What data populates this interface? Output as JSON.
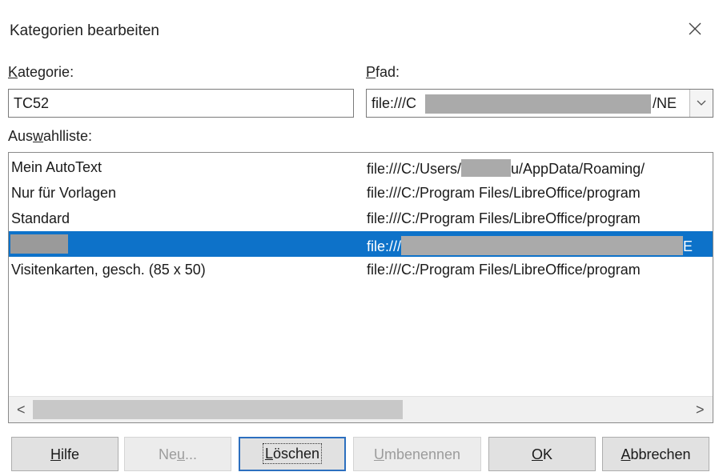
{
  "dialog": {
    "title": "Kategorien bearbeiten"
  },
  "labels": {
    "kategorie_accel": "K",
    "kategorie_rest": "ategorie:",
    "pfad_accel": "P",
    "pfad_rest": "fad:",
    "auswahl_pre": "Aus",
    "auswahl_accel": "w",
    "auswahl_rest": "ahlliste:"
  },
  "fields": {
    "kategorie_value": "TC52",
    "pfad_prefix": "file:///C",
    "pfad_suffix": "/NE"
  },
  "list": {
    "rows": [
      {
        "name": "Mein AutoText",
        "path_prefix": "file:///C:/Users/",
        "path_suffix": "u/AppData/Roaming/"
      },
      {
        "name": "Nur für Vorlagen",
        "path": "file:///C:/Program Files/LibreOffice/program"
      },
      {
        "name": "Standard",
        "path": "file:///C:/Program Files/LibreOffice/program"
      },
      {
        "name": "",
        "path_prefix": "file:///",
        "path_suffix": "E"
      },
      {
        "name": "Visitenkarten, gesch. (85 x 50)",
        "path": "file:///C:/Program Files/LibreOffice/program"
      }
    ]
  },
  "scroll": {
    "left": "<",
    "right": ">"
  },
  "buttons": {
    "hilfe_accel": "H",
    "hilfe_rest": "ilfe",
    "neu_pre": "Ne",
    "neu_accel": "u",
    "neu_rest": "...",
    "loeschen_accel": "L",
    "loeschen_rest": "öschen",
    "umbenennen_accel": "U",
    "umbenennen_rest": "mbenennen",
    "ok_accel": "O",
    "ok_rest": "K",
    "abbrechen_accel": "A",
    "abbrechen_rest": "bbrechen"
  },
  "colors": {
    "selection": "#0d72c9",
    "focus_border": "#2c6fbf"
  }
}
